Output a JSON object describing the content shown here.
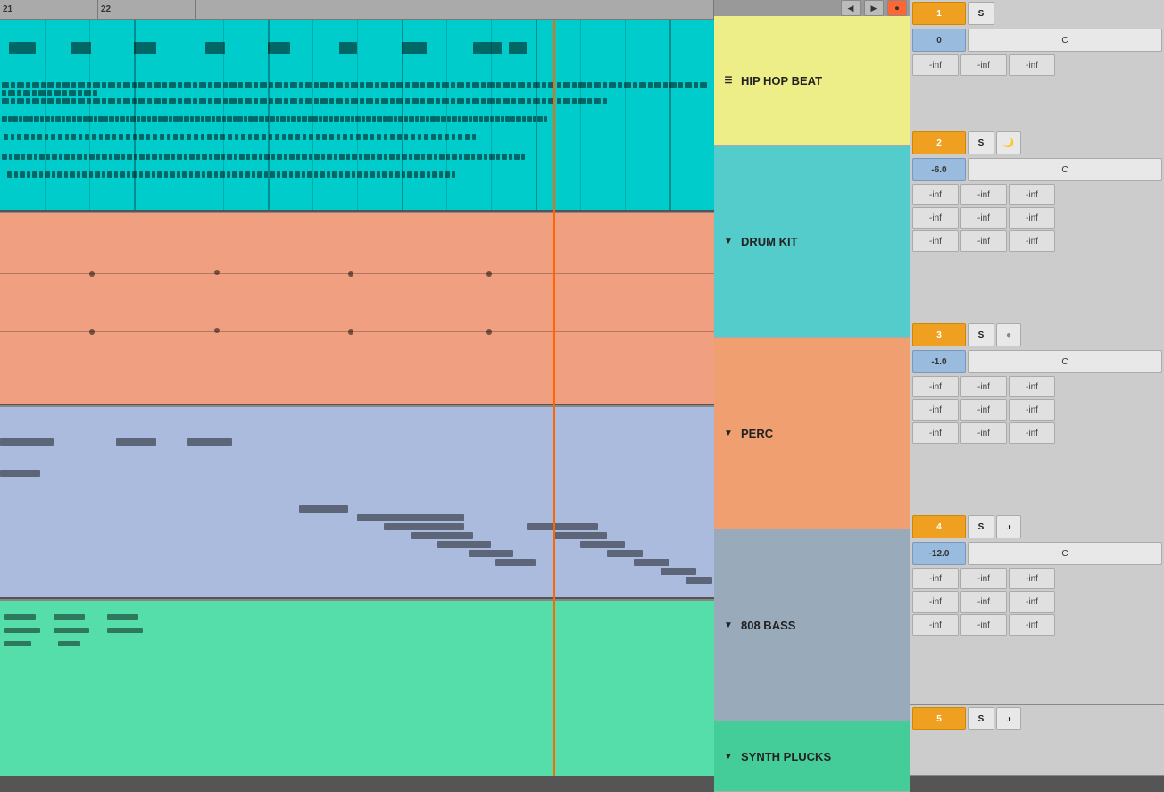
{
  "ruler": {
    "marks": [
      "21",
      "22",
      ""
    ]
  },
  "tracks": [
    {
      "id": "hiphop",
      "name": "HIP HOP BEAT",
      "color": "#EEEE88",
      "has_arrow": false,
      "arrow_dir": "",
      "track_num": "1",
      "volume": "0",
      "volume_color": "blue",
      "buttons": [
        "S"
      ],
      "inf_rows": [
        [
          "-inf",
          "-inf",
          "-inf"
        ]
      ]
    },
    {
      "id": "drumkit",
      "name": "DRUM KIT",
      "color": "#55CCCC",
      "has_arrow": true,
      "arrow_dir": "▼",
      "track_num": "2",
      "volume": "-6.0",
      "buttons": [
        "S"
      ],
      "inf_rows": [
        [
          "-inf",
          "-inf",
          "-inf"
        ],
        [
          "-inf",
          "-inf",
          "-inf"
        ],
        [
          "-inf",
          "-inf",
          "-inf"
        ]
      ]
    },
    {
      "id": "perc",
      "name": "PERC",
      "color": "#F0A070",
      "has_arrow": true,
      "arrow_dir": "▼",
      "track_num": "3",
      "volume": "-1.0",
      "buttons": [
        "S"
      ],
      "inf_rows": [
        [
          "-inf",
          "-inf",
          "-inf"
        ],
        [
          "-inf",
          "-inf",
          "-inf"
        ],
        [
          "-inf",
          "-inf",
          "-inf"
        ]
      ]
    },
    {
      "id": "bass808",
      "name": "808 BASS",
      "color": "#99AABB",
      "has_arrow": true,
      "arrow_dir": "▼",
      "track_num": "4",
      "volume": "-12.0",
      "buttons": [
        "S"
      ],
      "inf_rows": [
        [
          "-inf",
          "-inf",
          "-inf"
        ],
        [
          "-inf",
          "-inf",
          "-inf"
        ],
        [
          "-inf",
          "-inf",
          "-inf"
        ]
      ]
    },
    {
      "id": "synthplucks",
      "name": "SYNTH PLUCKS",
      "color": "#44CC99",
      "has_arrow": true,
      "arrow_dir": "▼",
      "track_num": "5",
      "volume": "",
      "buttons": [
        "S"
      ],
      "inf_rows": []
    }
  ],
  "nav_buttons": [
    "◀",
    "▶",
    "⏺"
  ],
  "labels": {
    "c": "C",
    "s": "S",
    "inf": "-inf"
  }
}
